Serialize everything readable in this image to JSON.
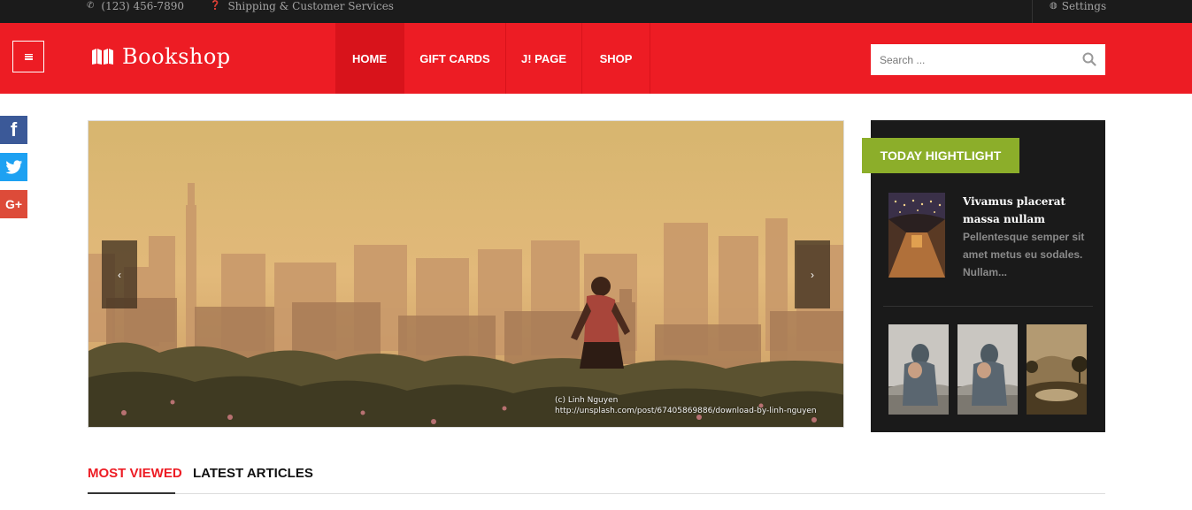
{
  "topbar": {
    "phone": "(123) 456-7890",
    "shipping": "Shipping & Customer Services",
    "settings": "Settings"
  },
  "header": {
    "logo": "Bookshop",
    "nav": [
      {
        "label": "HOME",
        "active": true
      },
      {
        "label": "GIFT CARDS",
        "active": false
      },
      {
        "label": "J! PAGE",
        "active": false
      },
      {
        "label": "SHOP",
        "active": false
      }
    ],
    "search_placeholder": "Search ..."
  },
  "slider": {
    "credit_line1": "(c) Linh Nguyen",
    "credit_line2": "http://unsplash.com/post/67405869886/download-by-linh-nguyen",
    "prev": "‹",
    "next": "›"
  },
  "highlight": {
    "title": "TODAY HIGHTLIGHT",
    "featured_title": "Vivamus placerat massa nullam",
    "featured_desc": "Pellentesque semper sit amet metus eu sodales. Nullam..."
  },
  "tabs": [
    {
      "label": "MOST VIEWED",
      "active": true
    },
    {
      "label": "LATEST ARTICLES",
      "active": false
    }
  ],
  "colors": {
    "brand_red": "#ed1c24",
    "highlight_green": "#8cae2a",
    "dark_panel": "#1a1a1a"
  }
}
